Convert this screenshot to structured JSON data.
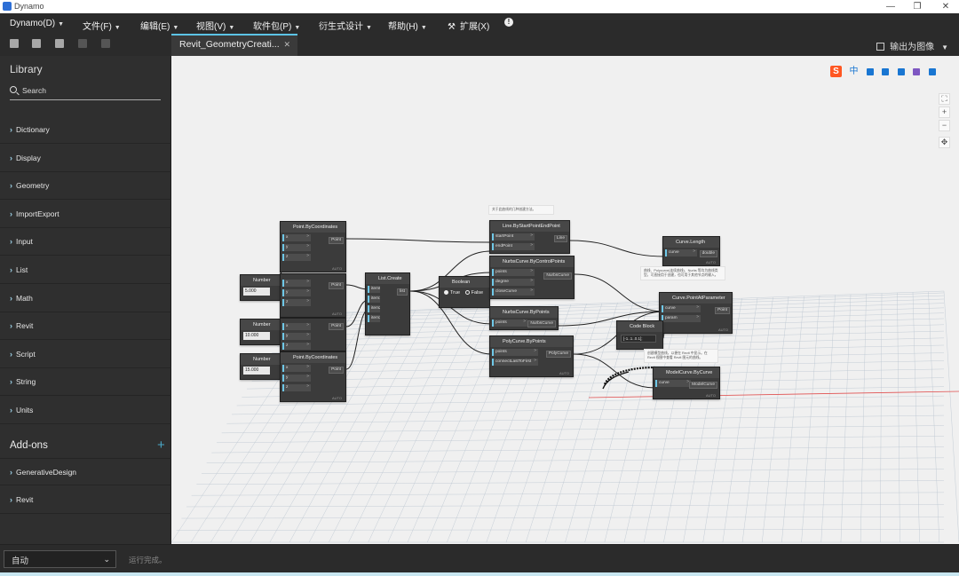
{
  "window": {
    "title": "Dynamo",
    "min": "—",
    "restore": "❐",
    "close": "✕"
  },
  "menubar": {
    "items": [
      "Dynamo(D)",
      "文件(F)",
      "编辑(E)",
      "视图(V)",
      "软件包(P)",
      "衍生式设计",
      "帮助(H)",
      "扩展(X)"
    ]
  },
  "toolbar": {
    "icons": [
      "new-file-icon",
      "open-folder-icon",
      "save-icon",
      "undo-icon",
      "redo-icon"
    ]
  },
  "tab": {
    "label": "Revit_GeometryCreati...",
    "close": "✕"
  },
  "export": {
    "label": "输出为图像"
  },
  "library": {
    "title": "Library",
    "search_placeholder": "Search",
    "categories": [
      "Dictionary",
      "Display",
      "Geometry",
      "ImportExport",
      "Input",
      "List",
      "Math",
      "Revit",
      "Script",
      "String",
      "Units"
    ],
    "addons_title": "Add-ons",
    "addons": [
      "GenerativeDesign",
      "Revit"
    ]
  },
  "nodes": {
    "number1": {
      "title": "Number",
      "value": "5.000"
    },
    "number2": {
      "title": "Number",
      "value": "10.000"
    },
    "number3": {
      "title": "Number",
      "value": "15.000"
    },
    "point_title": "Point.ByCoordinates",
    "xyz": [
      "x",
      "y",
      "z"
    ],
    "point_out": "Point",
    "list_create": {
      "title": "List.Create",
      "inputs": [
        "item0",
        "item1",
        "item2",
        "item3"
      ],
      "output": "list"
    },
    "boolean": {
      "title": "Boolean",
      "true_label": "True",
      "false_label": "False"
    },
    "line": {
      "title": "Line.ByStartPointEndPoint",
      "inputs": [
        "startPoint",
        "endPoint"
      ],
      "output": "Line"
    },
    "nurbs_cp": {
      "title": "NurbsCurve.ByControlPoints",
      "inputs": [
        "points",
        "degree",
        "closeCurve"
      ],
      "output": "NurbsCurve"
    },
    "nurbs_p": {
      "title": "NurbsCurve.ByPoints",
      "inputs": [
        "points"
      ],
      "output": "NurbsCurve"
    },
    "polycurve": {
      "title": "PolyCurve.ByPoints",
      "inputs": [
        "points",
        "connectLastToFirst"
      ],
      "output": "PolyCurve"
    },
    "curve_length": {
      "title": "Curve.Length",
      "inputs": [
        "curve"
      ],
      "output": "double"
    },
    "curve_pap": {
      "title": "Curve.PointAtParameter",
      "inputs": [
        "curve",
        "param"
      ],
      "output": "Point"
    },
    "code_block": {
      "title": "Code Block",
      "code": "[-1..1..0.1];"
    },
    "model_curve": {
      "title": "ModelCurve.ByCurve",
      "inputs": [
        "curve"
      ],
      "output": "ModelCurve"
    },
    "auto": "AUTO",
    "port_chevron": ">"
  },
  "notes": {
    "top": "关于此曲线的几种创建方法。",
    "mid": "曲线、Polycurve(连续曲线)、Nurbs 等均为曲线类型，可直接用于创建，也可用于其他节点的输入。",
    "bottom": "创建模型曲线，以便在 Revit 中显示。在 Revit 视图中查看 Revit 图元的曲线。"
  },
  "sogou": {
    "logo": "S",
    "lang": "中",
    "icons": [
      "punct-icon",
      "mic-icon",
      "keyboard-icon",
      "skin-icon",
      "toolbox-icon"
    ]
  },
  "canvas_tools": {
    "fit": "⛶",
    "zoom_in": "+",
    "zoom_out": "−",
    "pan": "✥"
  },
  "status": {
    "run_mode": "自动",
    "message": "运行完成。"
  }
}
